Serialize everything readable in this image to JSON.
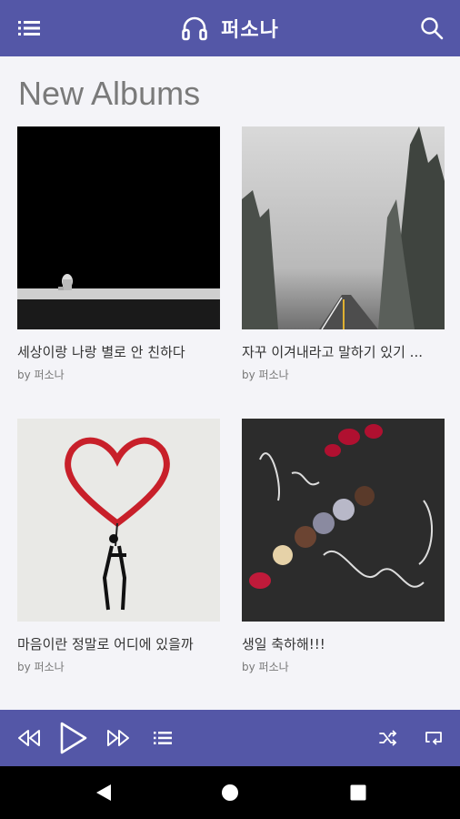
{
  "app": {
    "title": "퍼소나",
    "icons": {
      "menu": "list-menu-icon",
      "logo": "headphones-icon",
      "search": "search-icon"
    },
    "colors": {
      "primary": "#5457a7",
      "background": "#f4f4f8",
      "text": "#333333"
    }
  },
  "section": {
    "title": "New Albums"
  },
  "albums": [
    {
      "title": "세상이랑 나랑 별로 안 친하다",
      "by": "by 퍼소나",
      "art": "dark stage with sitting figure"
    },
    {
      "title": "자꾸 이겨내라고 말하기 있기 ...",
      "by": "by 퍼소나",
      "art": "foggy forest road"
    },
    {
      "title": "마음이란 정말로 어디에 있을까",
      "by": "by 퍼소나",
      "art": "red heart balloon drawing"
    },
    {
      "title": "생일 축하해!!!",
      "by": "by 퍼소나",
      "art": "happy birthday chalkboard dessert"
    }
  ],
  "player": {
    "icons": [
      "rewind-icon",
      "play-icon",
      "fast-forward-icon",
      "playlist-icon",
      "shuffle-icon",
      "repeat-icon"
    ]
  },
  "system_nav": {
    "icons": [
      "back-icon",
      "home-icon",
      "recents-icon"
    ]
  }
}
